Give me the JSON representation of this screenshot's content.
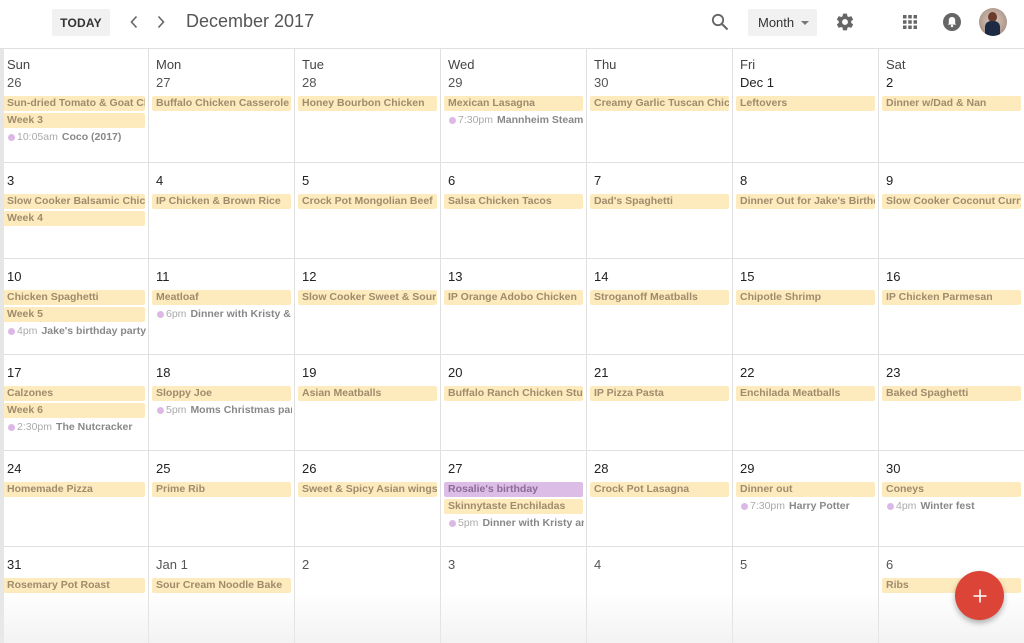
{
  "header": {
    "today_label": "TODAY",
    "prev_icon": "chevron-left-icon",
    "next_icon": "chevron-right-icon",
    "title": "December 2017",
    "search_icon": "search-icon",
    "view_select": {
      "selected": "Month"
    },
    "settings_icon": "gear-icon",
    "apps_icon": "apps-grid-icon",
    "notifications_icon": "bell-icon",
    "avatar": "user-avatar"
  },
  "colors": {
    "meal_event_bg": "#fdeabd",
    "meal_event_text": "#9e8c6d",
    "birthday_event_bg": "#dcbde6",
    "timed_dot": "#dcb8e6",
    "fab": "#db4437"
  },
  "day_names": [
    "Sun",
    "Mon",
    "Tue",
    "Wed",
    "Thu",
    "Fri",
    "Sat"
  ],
  "weeks": [
    {
      "days": [
        {
          "label": "26",
          "allday": [
            {
              "title": "Sun-dried Tomato & Goat Che"
            },
            {
              "title": "Week 3"
            }
          ],
          "timed": [
            {
              "time": "10:05am",
              "title": "Coco (2017)"
            }
          ]
        },
        {
          "label": "27",
          "allday": [
            {
              "title": "Buffalo Chicken Casserole"
            }
          ],
          "timed": []
        },
        {
          "label": "28",
          "allday": [
            {
              "title": "Honey Bourbon Chicken"
            }
          ],
          "timed": []
        },
        {
          "label": "29",
          "allday": [
            {
              "title": "Mexican Lasagna"
            }
          ],
          "timed": [
            {
              "time": "7:30pm",
              "title": "Mannheim Steamr"
            }
          ]
        },
        {
          "label": "30",
          "allday": [
            {
              "title": "Creamy Garlic Tuscan Chicke"
            }
          ],
          "timed": []
        },
        {
          "label": "Dec 1",
          "allday": [
            {
              "title": "Leftovers"
            }
          ],
          "timed": []
        },
        {
          "label": "2",
          "allday": [
            {
              "title": "Dinner w/Dad & Nan"
            }
          ],
          "timed": []
        }
      ]
    },
    {
      "days": [
        {
          "label": "3",
          "allday": [
            {
              "title": "Slow Cooker Balsamic Chicke"
            },
            {
              "title": "Week 4"
            }
          ],
          "timed": []
        },
        {
          "label": "4",
          "allday": [
            {
              "title": "IP Chicken & Brown Rice"
            }
          ],
          "timed": []
        },
        {
          "label": "5",
          "allday": [
            {
              "title": "Crock Pot Mongolian Beef"
            }
          ],
          "timed": []
        },
        {
          "label": "6",
          "allday": [
            {
              "title": "Salsa Chicken Tacos"
            }
          ],
          "timed": []
        },
        {
          "label": "7",
          "allday": [
            {
              "title": "Dad's Spaghetti"
            }
          ],
          "timed": []
        },
        {
          "label": "8",
          "allday": [
            {
              "title": "Dinner Out for Jake's Birthday"
            }
          ],
          "timed": []
        },
        {
          "label": "9",
          "allday": [
            {
              "title": "Slow Cooker Coconut Curry C"
            }
          ],
          "timed": []
        }
      ]
    },
    {
      "days": [
        {
          "label": "10",
          "allday": [
            {
              "title": "Chicken Spaghetti"
            },
            {
              "title": "Week 5"
            }
          ],
          "timed": [
            {
              "time": "4pm",
              "title": "Jake's birthday party"
            }
          ]
        },
        {
          "label": "11",
          "allday": [
            {
              "title": "Meatloaf"
            }
          ],
          "timed": [
            {
              "time": "6pm",
              "title": "Dinner with Kristy & C"
            }
          ]
        },
        {
          "label": "12",
          "allday": [
            {
              "title": "Slow Cooker Sweet & Sour M"
            }
          ],
          "timed": []
        },
        {
          "label": "13",
          "allday": [
            {
              "title": "IP Orange Adobo Chicken"
            }
          ],
          "timed": []
        },
        {
          "label": "14",
          "allday": [
            {
              "title": "Stroganoff Meatballs"
            }
          ],
          "timed": []
        },
        {
          "label": "15",
          "allday": [
            {
              "title": "Chipotle Shrimp"
            }
          ],
          "timed": []
        },
        {
          "label": "16",
          "allday": [
            {
              "title": "IP Chicken Parmesan"
            }
          ],
          "timed": []
        }
      ]
    },
    {
      "days": [
        {
          "label": "17",
          "allday": [
            {
              "title": "Calzones"
            },
            {
              "title": "Week 6"
            }
          ],
          "timed": [
            {
              "time": "2:30pm",
              "title": "The Nutcracker"
            }
          ]
        },
        {
          "label": "18",
          "allday": [
            {
              "title": "Sloppy Joe"
            }
          ],
          "timed": [
            {
              "time": "5pm",
              "title": "Moms Christmas part"
            }
          ]
        },
        {
          "label": "19",
          "allday": [
            {
              "title": "Asian Meatballs"
            }
          ],
          "timed": []
        },
        {
          "label": "20",
          "allday": [
            {
              "title": "Buffalo Ranch Chicken Stuffe"
            }
          ],
          "timed": []
        },
        {
          "label": "21",
          "allday": [
            {
              "title": "IP Pizza Pasta"
            }
          ],
          "timed": []
        },
        {
          "label": "22",
          "allday": [
            {
              "title": "Enchilada Meatballs"
            }
          ],
          "timed": []
        },
        {
          "label": "23",
          "allday": [
            {
              "title": "Baked Spaghetti"
            }
          ],
          "timed": []
        }
      ]
    },
    {
      "days": [
        {
          "label": "24",
          "allday": [
            {
              "title": "Homemade Pizza"
            }
          ],
          "timed": []
        },
        {
          "label": "25",
          "allday": [
            {
              "title": "Prime Rib"
            }
          ],
          "timed": []
        },
        {
          "label": "26",
          "allday": [
            {
              "title": "Sweet & Spicy Asian wings"
            }
          ],
          "timed": []
        },
        {
          "label": "27",
          "allday": [
            {
              "title": "Rosalie's birthday",
              "color": "purple"
            },
            {
              "title": "Skinnytaste Enchiladas"
            }
          ],
          "timed": [
            {
              "time": "5pm",
              "title": "Dinner with Kristy and"
            }
          ]
        },
        {
          "label": "28",
          "allday": [
            {
              "title": "Crock Pot Lasagna"
            }
          ],
          "timed": []
        },
        {
          "label": "29",
          "allday": [
            {
              "title": "Dinner out"
            }
          ],
          "timed": [
            {
              "time": "7:30pm",
              "title": "Harry Potter"
            }
          ]
        },
        {
          "label": "30",
          "allday": [
            {
              "title": "Coneys"
            }
          ],
          "timed": [
            {
              "time": "4pm",
              "title": "Winter fest"
            }
          ]
        }
      ]
    },
    {
      "days": [
        {
          "label": "31",
          "allday": [
            {
              "title": "Rosemary Pot Roast"
            }
          ],
          "timed": []
        },
        {
          "label": "Jan 1",
          "allday": [
            {
              "title": "Sour Cream Noodle Bake"
            }
          ],
          "timed": []
        },
        {
          "label": "2",
          "allday": [],
          "timed": []
        },
        {
          "label": "3",
          "allday": [],
          "timed": []
        },
        {
          "label": "4",
          "allday": [],
          "timed": []
        },
        {
          "label": "5",
          "allday": [],
          "timed": []
        },
        {
          "label": "6",
          "allday": [
            {
              "title": "Ribs"
            }
          ],
          "timed": []
        }
      ]
    }
  ],
  "fab": {
    "icon": "plus-icon",
    "label": "Create event"
  }
}
